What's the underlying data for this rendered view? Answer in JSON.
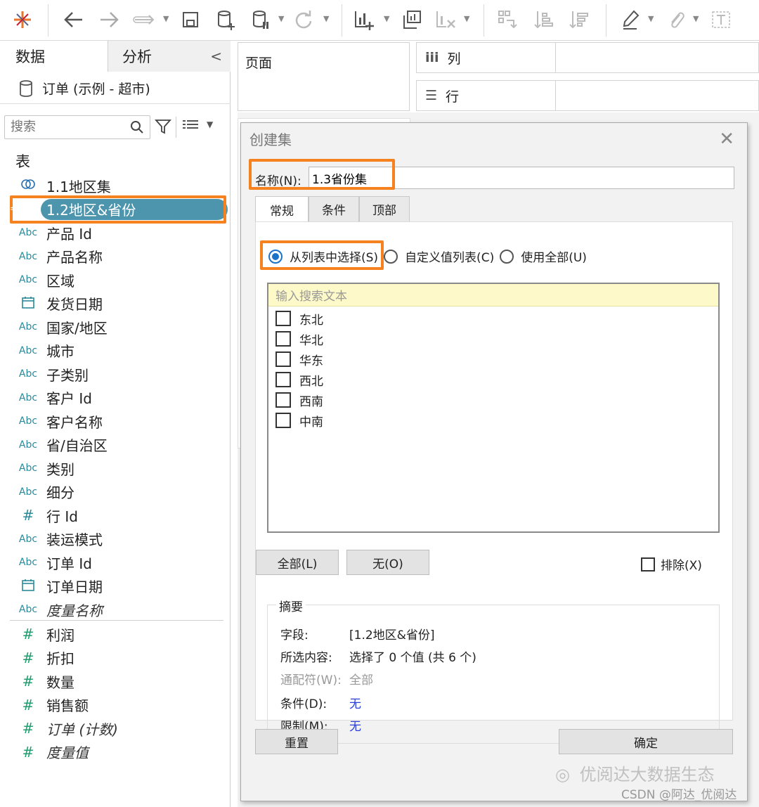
{
  "toolbar": {
    "icons": [
      "tableau-logo-icon",
      "back-icon",
      "forward-icon",
      "redo-icon",
      "save-icon",
      "new-datasource-icon",
      "pause-update-icon",
      "refresh-icon",
      "new-worksheet-icon",
      "duplicate-icon",
      "clear-icon",
      "swap-icon",
      "sort-asc-icon",
      "sort-desc-icon",
      "highlight-icon",
      "annotate-icon",
      "text-icon"
    ]
  },
  "leftpane": {
    "tab_data": "数据",
    "tab_analysis": "分析",
    "datasource": "订单 (示例 - 超市)",
    "search_placeholder": "搜索",
    "section_title": "表",
    "fields": [
      {
        "icon": "◎",
        "label": "1.1地区集",
        "type": "set"
      },
      {
        "icon": "=Abc",
        "label": "1.2地区&省份",
        "type": "calc",
        "selected": true
      },
      {
        "icon": "Abc",
        "label": "产品 Id"
      },
      {
        "icon": "Abc",
        "label": "产品名称"
      },
      {
        "icon": "Abc",
        "label": "区域"
      },
      {
        "icon": "date",
        "label": "发货日期"
      },
      {
        "icon": "Abc",
        "label": "国家/地区"
      },
      {
        "icon": "Abc",
        "label": "城市"
      },
      {
        "icon": "Abc",
        "label": "子类别"
      },
      {
        "icon": "Abc",
        "label": "客户 Id"
      },
      {
        "icon": "Abc",
        "label": "客户名称"
      },
      {
        "icon": "Abc",
        "label": "省/自治区"
      },
      {
        "icon": "Abc",
        "label": "类别"
      },
      {
        "icon": "Abc",
        "label": "细分"
      },
      {
        "icon": "#",
        "label": "行 Id"
      },
      {
        "icon": "Abc",
        "label": "装运模式"
      },
      {
        "icon": "Abc",
        "label": "订单 Id"
      },
      {
        "icon": "date",
        "label": "订单日期"
      },
      {
        "icon": "Abc",
        "label": "度量名称",
        "italic": true
      }
    ],
    "measures": [
      {
        "label": "利润"
      },
      {
        "label": "折扣"
      },
      {
        "label": "数量"
      },
      {
        "label": "销售额"
      },
      {
        "label": "订单 (计数)",
        "italic": true
      },
      {
        "label": "度量值",
        "italic": true
      }
    ]
  },
  "shelves": {
    "pages": "页面",
    "columns_icon": "iii",
    "columns": "列",
    "rows_icon": "☰",
    "rows": "行"
  },
  "dialog": {
    "title": "创建集",
    "name_label": "名称(N):",
    "name_value": "1.3省份集",
    "tabs": [
      "常规",
      "条件",
      "顶部"
    ],
    "radio_from_list": "从列表中选择(S)",
    "radio_custom": "自定义值列表(C)",
    "radio_all": "使用全部(U)",
    "list_search_placeholder": "输入搜索文本",
    "items": [
      "东北",
      "华北",
      "华东",
      "西北",
      "西南",
      "中南"
    ],
    "btn_all": "全部(L)",
    "btn_none": "无(O)",
    "exclude_label": "排除(X)",
    "summary_title": "摘要",
    "summary": {
      "field_key": "字段:",
      "field_value": "[1.2地区&省份]",
      "selected_key": "所选内容:",
      "selected_value": "选择了 0 个值 (共 6 个)",
      "wildcard_key": "通配符(W):",
      "wildcard_value": "全部",
      "condition_key": "条件(D):",
      "condition_value": "无",
      "limit_key": "限制(M):",
      "limit_value": "无"
    },
    "btn_reset": "重置",
    "btn_ok": "确定"
  },
  "watermark": {
    "line1": "优阅达大数据生态",
    "line2": "CSDN @阿达_优阅达"
  },
  "colors": {
    "highlight_orange": "#f5821f",
    "selected_pill": "#4d94ad",
    "dimension_icon": "#2a8a9a",
    "measure_icon": "#1f9d6f",
    "radio_blue": "#1a73c9",
    "link_blue": "#2b3fd6",
    "search_yellow": "#fdf9c9"
  }
}
